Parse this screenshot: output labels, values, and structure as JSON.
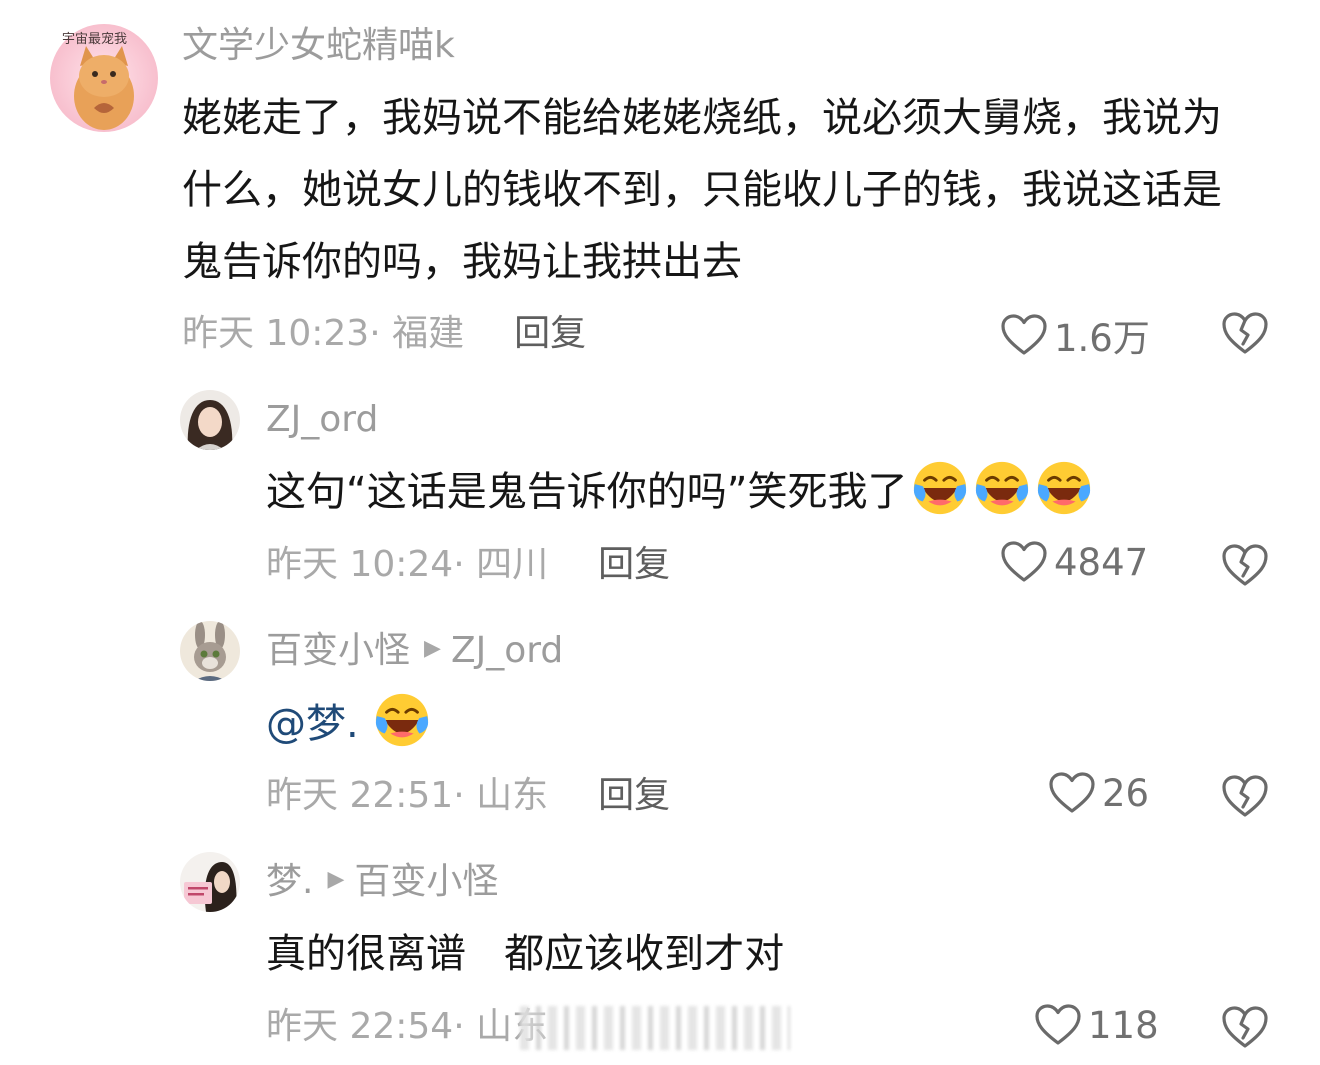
{
  "comments": [
    {
      "username": "文学少女蛇精喵k",
      "avatar_label": "宇宙最宠我",
      "text": "姥姥走了，我妈说不能给姥姥烧纸，说必须大舅烧，我说为什么，她说女儿的钱收不到，只能收儿子的钱，我说这话是鬼告诉你的吗，我妈让我拱出去",
      "time_location": "昨天 10:23· 福建",
      "reply_label": "回复",
      "likes": "1.6万"
    },
    {
      "username": "ZJ_ord",
      "text": "这句“这话是鬼告诉你的吗”笑死我了",
      "emoji": [
        "face-with-tears-of-joy-emoji",
        "face-with-tears-of-joy-emoji",
        "face-with-tears-of-joy-emoji"
      ],
      "time_location": "昨天 10:24· 四川",
      "reply_label": "回复",
      "likes": "4847"
    },
    {
      "username": "百变小怪",
      "reply_to": "ZJ_ord",
      "mention": "@梦.",
      "emoji": [
        "face-with-tears-of-joy-emoji"
      ],
      "time_location": "昨天 22:51· 山东",
      "reply_label": "回复",
      "likes": "26"
    },
    {
      "username": "梦.",
      "reply_to": "百变小怪",
      "text": "真的很离谱   都应该收到才对",
      "time_location": "昨天 22:54· 山东",
      "likes": "118"
    }
  ],
  "icons": {
    "like": "heart-outline-icon",
    "dislike": "broken-heart-icon",
    "reply_arrow": "play-triangle-icon"
  },
  "colors": {
    "text": "#161616",
    "username": "#9c9c9c",
    "meta": "#a9a9a9",
    "reply": "#5e5e5e",
    "mention": "#1f4a78",
    "icon": "#6a6a6a"
  }
}
